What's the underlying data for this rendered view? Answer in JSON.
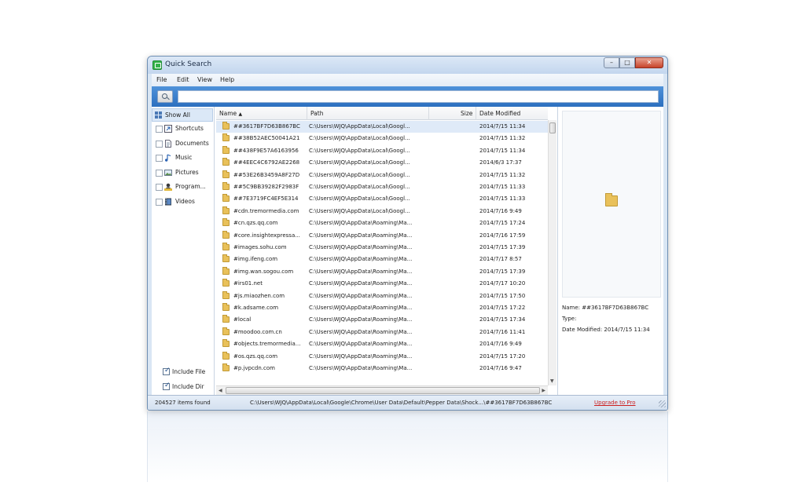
{
  "window": {
    "title": "Quick Search"
  },
  "menu": [
    "File",
    "Edit",
    "View",
    "Help"
  ],
  "search": {
    "value": "",
    "placeholder": ""
  },
  "sidebar": {
    "items": [
      {
        "label": "Show All",
        "icon": "grid-icon"
      },
      {
        "label": "Shortcuts",
        "icon": "shortcut-icon"
      },
      {
        "label": "Documents",
        "icon": "document-icon"
      },
      {
        "label": "Music",
        "icon": "music-icon"
      },
      {
        "label": "Pictures",
        "icon": "picture-icon"
      },
      {
        "label": "Program...",
        "icon": "program-icon"
      },
      {
        "label": "Videos",
        "icon": "video-icon"
      }
    ],
    "options": [
      {
        "label": "Include File",
        "checked": true
      },
      {
        "label": "Include Dir",
        "checked": true
      }
    ]
  },
  "columns": {
    "name": "Name",
    "path": "Path",
    "size": "Size",
    "date": "Date Modified"
  },
  "rows": [
    {
      "name": "##3617BF7D63B867BC",
      "path": "C:\\Users\\WJQ\\AppData\\Local\\Googl...",
      "size": "",
      "date": "2014/7/15 11:34",
      "selected": true
    },
    {
      "name": "##38B52AEC50041A21",
      "path": "C:\\Users\\WJQ\\AppData\\Local\\Googl...",
      "size": "",
      "date": "2014/7/15 11:32"
    },
    {
      "name": "##438F9E57A6163956",
      "path": "C:\\Users\\WJQ\\AppData\\Local\\Googl...",
      "size": "",
      "date": "2014/7/15 11:34"
    },
    {
      "name": "##4EEC4C6792AE2268",
      "path": "C:\\Users\\WJQ\\AppData\\Local\\Googl...",
      "size": "",
      "date": "2014/6/3 17:37"
    },
    {
      "name": "##53E26B3459A8F27D",
      "path": "C:\\Users\\WJQ\\AppData\\Local\\Googl...",
      "size": "",
      "date": "2014/7/15 11:32"
    },
    {
      "name": "##5C9BB39282F2983F",
      "path": "C:\\Users\\WJQ\\AppData\\Local\\Googl...",
      "size": "",
      "date": "2014/7/15 11:33"
    },
    {
      "name": "##7E3719FC4EF5E314",
      "path": "C:\\Users\\WJQ\\AppData\\Local\\Googl...",
      "size": "",
      "date": "2014/7/15 11:33"
    },
    {
      "name": "#cdn.tremormedia.com",
      "path": "C:\\Users\\WJQ\\AppData\\Local\\Googl...",
      "size": "",
      "date": "2014/7/16 9:49"
    },
    {
      "name": "#cn.qzs.qq.com",
      "path": "C:\\Users\\WJQ\\AppData\\Roaming\\Ma...",
      "size": "",
      "date": "2014/7/15 17:24"
    },
    {
      "name": "#core.insightexpressa...",
      "path": "C:\\Users\\WJQ\\AppData\\Roaming\\Ma...",
      "size": "",
      "date": "2014/7/16 17:59"
    },
    {
      "name": "#images.sohu.com",
      "path": "C:\\Users\\WJQ\\AppData\\Roaming\\Ma...",
      "size": "",
      "date": "2014/7/15 17:39"
    },
    {
      "name": "#img.ifeng.com",
      "path": "C:\\Users\\WJQ\\AppData\\Roaming\\Ma...",
      "size": "",
      "date": "2014/7/17 8:57"
    },
    {
      "name": "#img.wan.sogou.com",
      "path": "C:\\Users\\WJQ\\AppData\\Roaming\\Ma...",
      "size": "",
      "date": "2014/7/15 17:39"
    },
    {
      "name": "#irs01.net",
      "path": "C:\\Users\\WJQ\\AppData\\Roaming\\Ma...",
      "size": "",
      "date": "2014/7/17 10:20"
    },
    {
      "name": "#js.miaozhen.com",
      "path": "C:\\Users\\WJQ\\AppData\\Roaming\\Ma...",
      "size": "",
      "date": "2014/7/15 17:50"
    },
    {
      "name": "#k.adsame.com",
      "path": "C:\\Users\\WJQ\\AppData\\Roaming\\Ma...",
      "size": "",
      "date": "2014/7/15 17:22"
    },
    {
      "name": "#local",
      "path": "C:\\Users\\WJQ\\AppData\\Roaming\\Ma...",
      "size": "",
      "date": "2014/7/15 17:34"
    },
    {
      "name": "#moodoo.com.cn",
      "path": "C:\\Users\\WJQ\\AppData\\Roaming\\Ma...",
      "size": "",
      "date": "2014/7/16 11:41"
    },
    {
      "name": "#objects.tremormedia...",
      "path": "C:\\Users\\WJQ\\AppData\\Roaming\\Ma...",
      "size": "",
      "date": "2014/7/16 9:49"
    },
    {
      "name": "#os.qzs.qq.com",
      "path": "C:\\Users\\WJQ\\AppData\\Roaming\\Ma...",
      "size": "",
      "date": "2014/7/15 17:20"
    },
    {
      "name": "#p.jvpcdn.com",
      "path": "C:\\Users\\WJQ\\AppData\\Roaming\\Ma...",
      "size": "",
      "date": "2014/7/16 9:47"
    }
  ],
  "preview": {
    "name_label": "Name:",
    "name_value": "##3617BF7D63B867BC",
    "type_label": "Type:",
    "type_value": "",
    "date_label": "Date Modified:",
    "date_value": "2014/7/15 11:34"
  },
  "status": {
    "count": "204527 items found",
    "path": "C:\\Users\\WJQ\\AppData\\Local\\Google\\Chrome\\User Data\\Default\\Pepper Data\\Shock...\\##3617BF7D63B867BC",
    "upgrade": "Upgrade to Pro"
  },
  "colors": {
    "accent": "#2c6fbf",
    "upgrade_link": "#cc1f1f",
    "folder": "#e9c15a"
  }
}
